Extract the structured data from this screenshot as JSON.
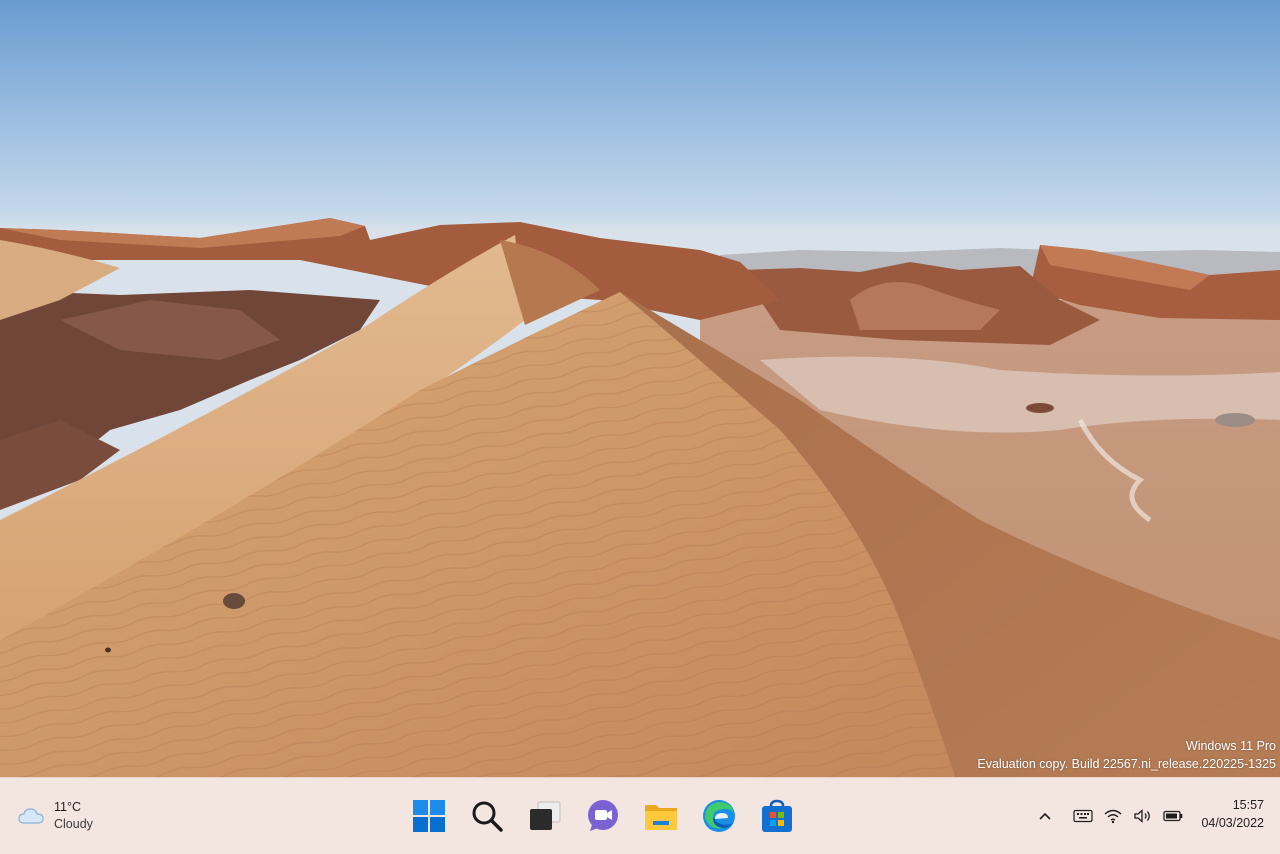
{
  "desktop": {
    "watermark": {
      "edition": "Windows 11 Pro",
      "build": "Evaluation copy. Build 22567.ni_release.220225-1325"
    }
  },
  "taskbar": {
    "background": "#f3e5df",
    "weather": {
      "temperature": "11°C",
      "condition": "Cloudy",
      "icon": "cloud-icon"
    },
    "apps": [
      {
        "name": "start-button",
        "icon": "windows-logo-icon"
      },
      {
        "name": "search-button",
        "icon": "search-icon"
      },
      {
        "name": "task-view-button",
        "icon": "task-view-icon"
      },
      {
        "name": "teams-chat-button",
        "icon": "teams-chat-icon"
      },
      {
        "name": "file-explorer-button",
        "icon": "folder-icon"
      },
      {
        "name": "edge-button",
        "icon": "edge-icon"
      },
      {
        "name": "store-button",
        "icon": "store-icon"
      }
    ],
    "tray": {
      "icons": [
        "chevron-up-icon",
        "keyboard-icon",
        "wifi-icon",
        "speaker-icon",
        "battery-icon"
      ]
    },
    "clock": {
      "time": "15:57",
      "date": "04/03/2022"
    }
  },
  "colors": {
    "accent": "#0078d4",
    "sand": "#c8956a",
    "sky": "#8fb4dc"
  }
}
